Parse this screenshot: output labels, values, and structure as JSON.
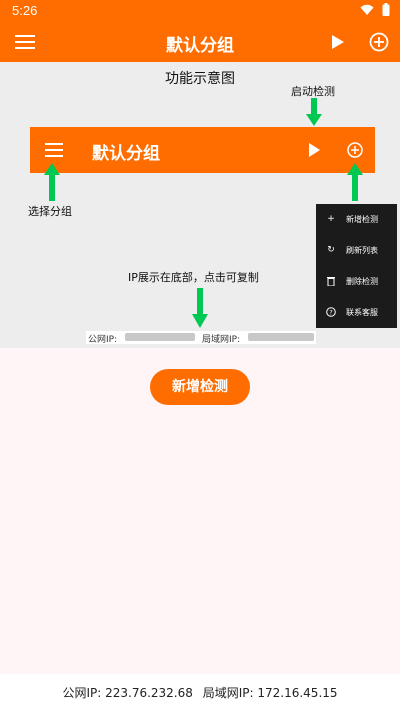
{
  "status_bar": {
    "time": "5:26",
    "icons": [
      "wifi-icon",
      "battery-icon"
    ]
  },
  "app_bar": {
    "title": "默认分组",
    "icons": [
      "menu-icon",
      "play-icon",
      "add-circle-icon"
    ]
  },
  "demo": {
    "title": "功能示意图",
    "toolbar_title": "默认分组",
    "labels": {
      "start": "启动检测",
      "select_group": "选择分组",
      "ip_hint": "IP展示在底部，点击可复制"
    },
    "menu_items": [
      {
        "icon": "plus-icon",
        "label": "新增检测"
      },
      {
        "icon": "refresh-icon",
        "label": "刷新列表"
      },
      {
        "icon": "trash-icon",
        "label": "删除检测"
      },
      {
        "icon": "help-icon",
        "label": "联系客服"
      }
    ],
    "ip_strip": {
      "public_label": "公网IP:",
      "lan_label": "局域网IP:"
    }
  },
  "main": {
    "add_button": "新增检测"
  },
  "footer": {
    "public_ip": "公网IP: 223.76.232.68",
    "lan_ip": "局域网IP: 172.16.45.15"
  },
  "colors": {
    "accent": "#ff6d00",
    "arrow": "#00c853",
    "content_bg": "#fff4f6",
    "demo_bg": "#ededed",
    "menu_bg": "#1b1b1b"
  }
}
